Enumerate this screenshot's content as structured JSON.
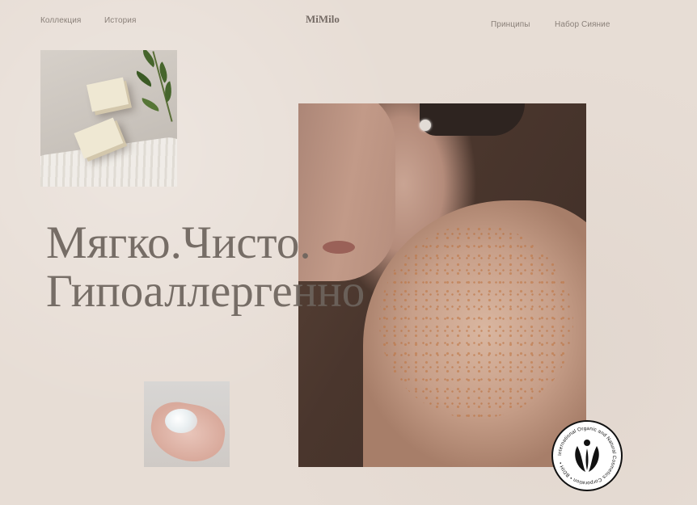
{
  "brand": {
    "logo": "MiMilo"
  },
  "nav": {
    "left": [
      "Коллекция",
      "История"
    ],
    "right": [
      "Принципы",
      "Набор Сияние"
    ]
  },
  "hero": {
    "headline_line1": "Мягко.Чисто.",
    "headline_line2": "Гипоаллергенно"
  },
  "badge": {
    "text": "International Organic and Natural Cosmetics Corporation • BDIH •"
  },
  "images": {
    "soap": "soap-bars-with-leaves",
    "model": "woman-freckled-shoulder",
    "hand": "hand-holding-gel"
  },
  "colors": {
    "background": "#e7ddd5",
    "text": "#6d645d",
    "nav_text": "#8a8079"
  }
}
